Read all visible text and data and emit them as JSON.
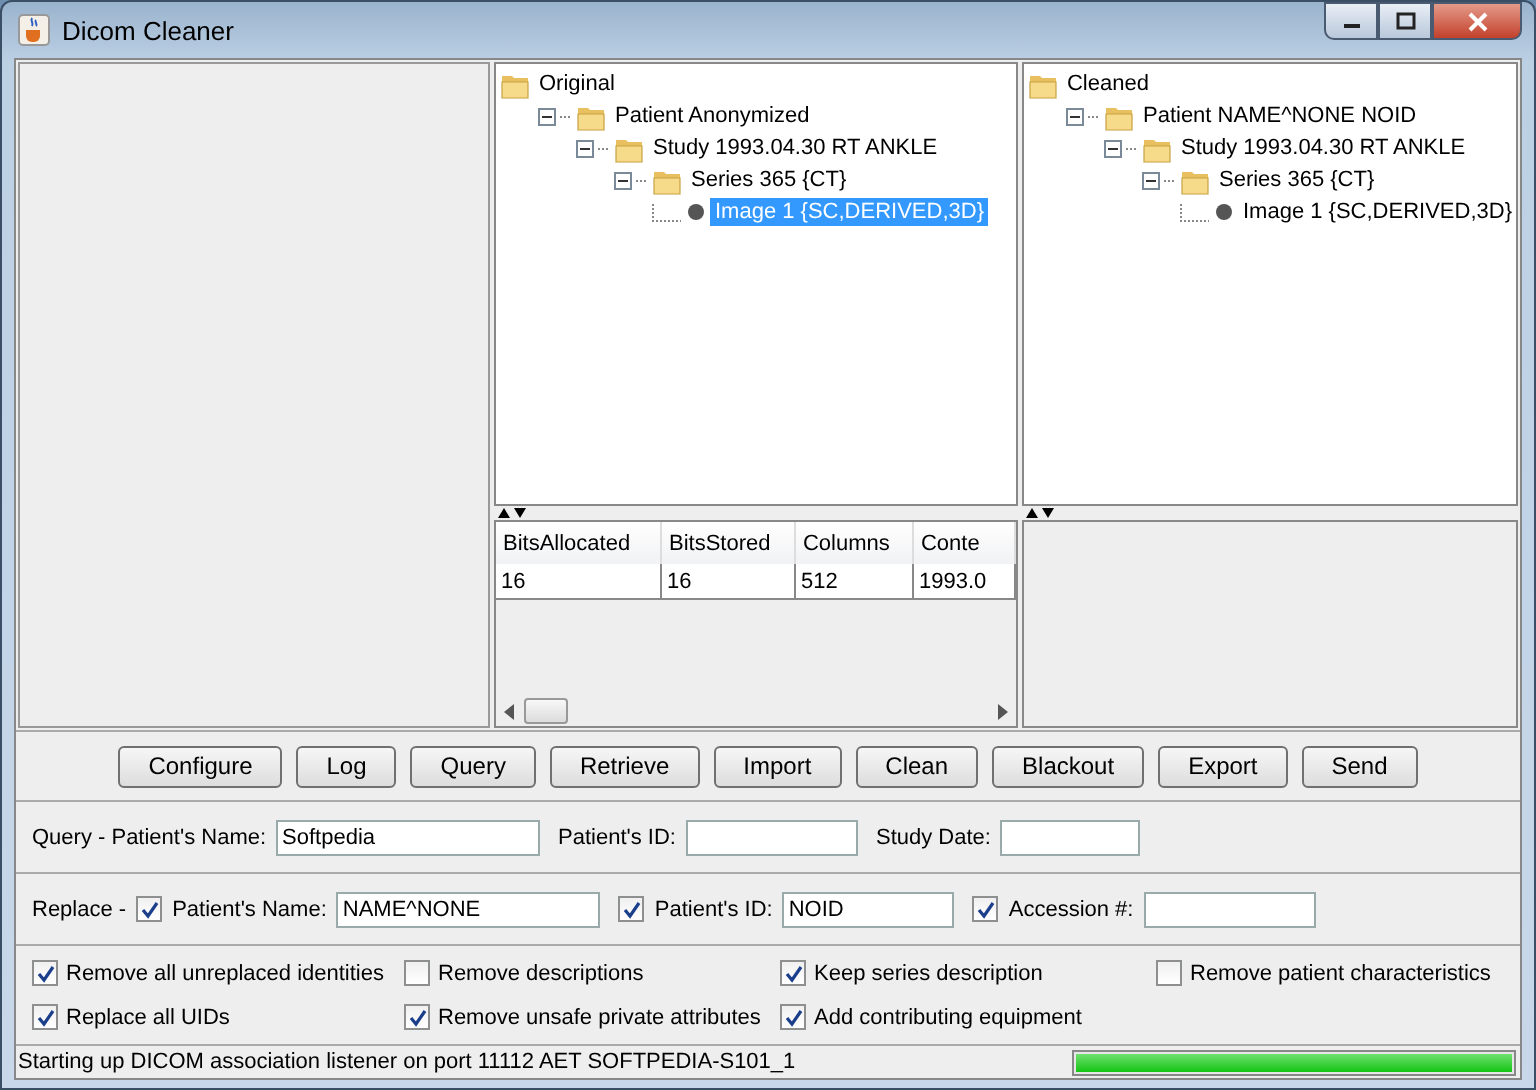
{
  "window": {
    "title": "Dicom Cleaner"
  },
  "original_tree": {
    "label": "Original",
    "selected": false,
    "children": [
      {
        "label": "Patient Anonymized",
        "selected": false,
        "expanded": true,
        "children": [
          {
            "label": "Study 1993.04.30 RT ANKLE",
            "selected": false,
            "expanded": true,
            "children": [
              {
                "label": "Series 365 {CT}",
                "selected": false,
                "expanded": true,
                "children": [
                  {
                    "label": "Image 1 {SC,DERIVED,3D}",
                    "selected": true
                  }
                ]
              }
            ]
          }
        ]
      }
    ]
  },
  "attributes_table": {
    "columns": [
      "BitsAllocated",
      "BitsStored",
      "Columns",
      "Conte"
    ],
    "rows": [
      [
        "16",
        "16",
        "512",
        "1993.0"
      ]
    ]
  },
  "cleaned_tree": {
    "label": "Cleaned",
    "selected": false,
    "children": [
      {
        "label": "Patient NAME^NONE NOID",
        "selected": false,
        "expanded": true,
        "children": [
          {
            "label": "Study 1993.04.30 RT ANKLE",
            "selected": false,
            "expanded": true,
            "children": [
              {
                "label": "Series 365 {CT}",
                "selected": false,
                "expanded": true,
                "children": [
                  {
                    "label": "Image 1 {SC,DERIVED,3D}",
                    "selected": false
                  }
                ]
              }
            ]
          }
        ]
      }
    ]
  },
  "buttons": [
    "Configure",
    "Log",
    "Query",
    "Retrieve",
    "Import",
    "Clean",
    "Blackout",
    "Export",
    "Send"
  ],
  "query": {
    "label": "Query - Patient's Name:",
    "fields": [
      {
        "label": "Patient's ID:"
      },
      {
        "label": "Study Date:"
      }
    ],
    "name_value": "Softpedia"
  },
  "replace": {
    "label": "Replace -",
    "fields": [
      {
        "label": "Patient's Name:",
        "checked": true,
        "value": "NAME^NONE"
      },
      {
        "label": "Patient's ID:",
        "checked": true,
        "value": "NOID"
      },
      {
        "label": "Accession #:",
        "checked": true
      }
    ]
  },
  "options": [
    {
      "label": "Remove all unreplaced identities",
      "checked": true
    },
    {
      "label": "Remove descriptions",
      "checked": false
    },
    {
      "label": "Keep series description",
      "checked": true
    },
    {
      "label": "Remove patient characteristics",
      "checked": false
    },
    {
      "label": "Replace all UIDs",
      "checked": true
    },
    {
      "label": "Remove unsafe private attributes",
      "checked": true
    },
    {
      "label": "Add contributing equipment",
      "checked": true
    }
  ],
  "status_bar": {
    "message": "Starting up DICOM association listener on port 11112 AET SOFTPEDIA-S101_1",
    "progress": {
      "level": 1.0
    }
  }
}
